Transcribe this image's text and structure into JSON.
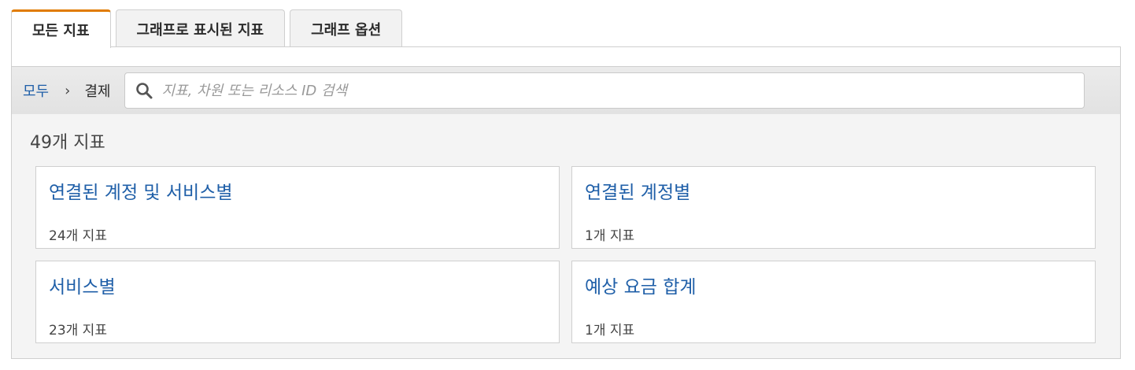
{
  "tabs": [
    {
      "label": "모든 지표",
      "active": true
    },
    {
      "label": "그래프로 표시된 지표",
      "active": false
    },
    {
      "label": "그래프 옵션",
      "active": false
    }
  ],
  "breadcrumb": {
    "root": "모두",
    "separator": "›",
    "current": "결제"
  },
  "search": {
    "placeholder": "지표, 차원 또는 리소스 ID 검색",
    "value": "",
    "icon": "search-icon"
  },
  "summary": {
    "count_label": "49개 지표"
  },
  "categories": [
    {
      "title": "연결된 계정 및 서비스별",
      "count_label": "24개 지표"
    },
    {
      "title": "연결된 계정별",
      "count_label": "1개 지표"
    },
    {
      "title": "서비스별",
      "count_label": "23개 지표"
    },
    {
      "title": "예상 요금 합계",
      "count_label": "1개 지표"
    }
  ],
  "colors": {
    "accent": "#e07b00",
    "link": "#1f5fa8"
  }
}
